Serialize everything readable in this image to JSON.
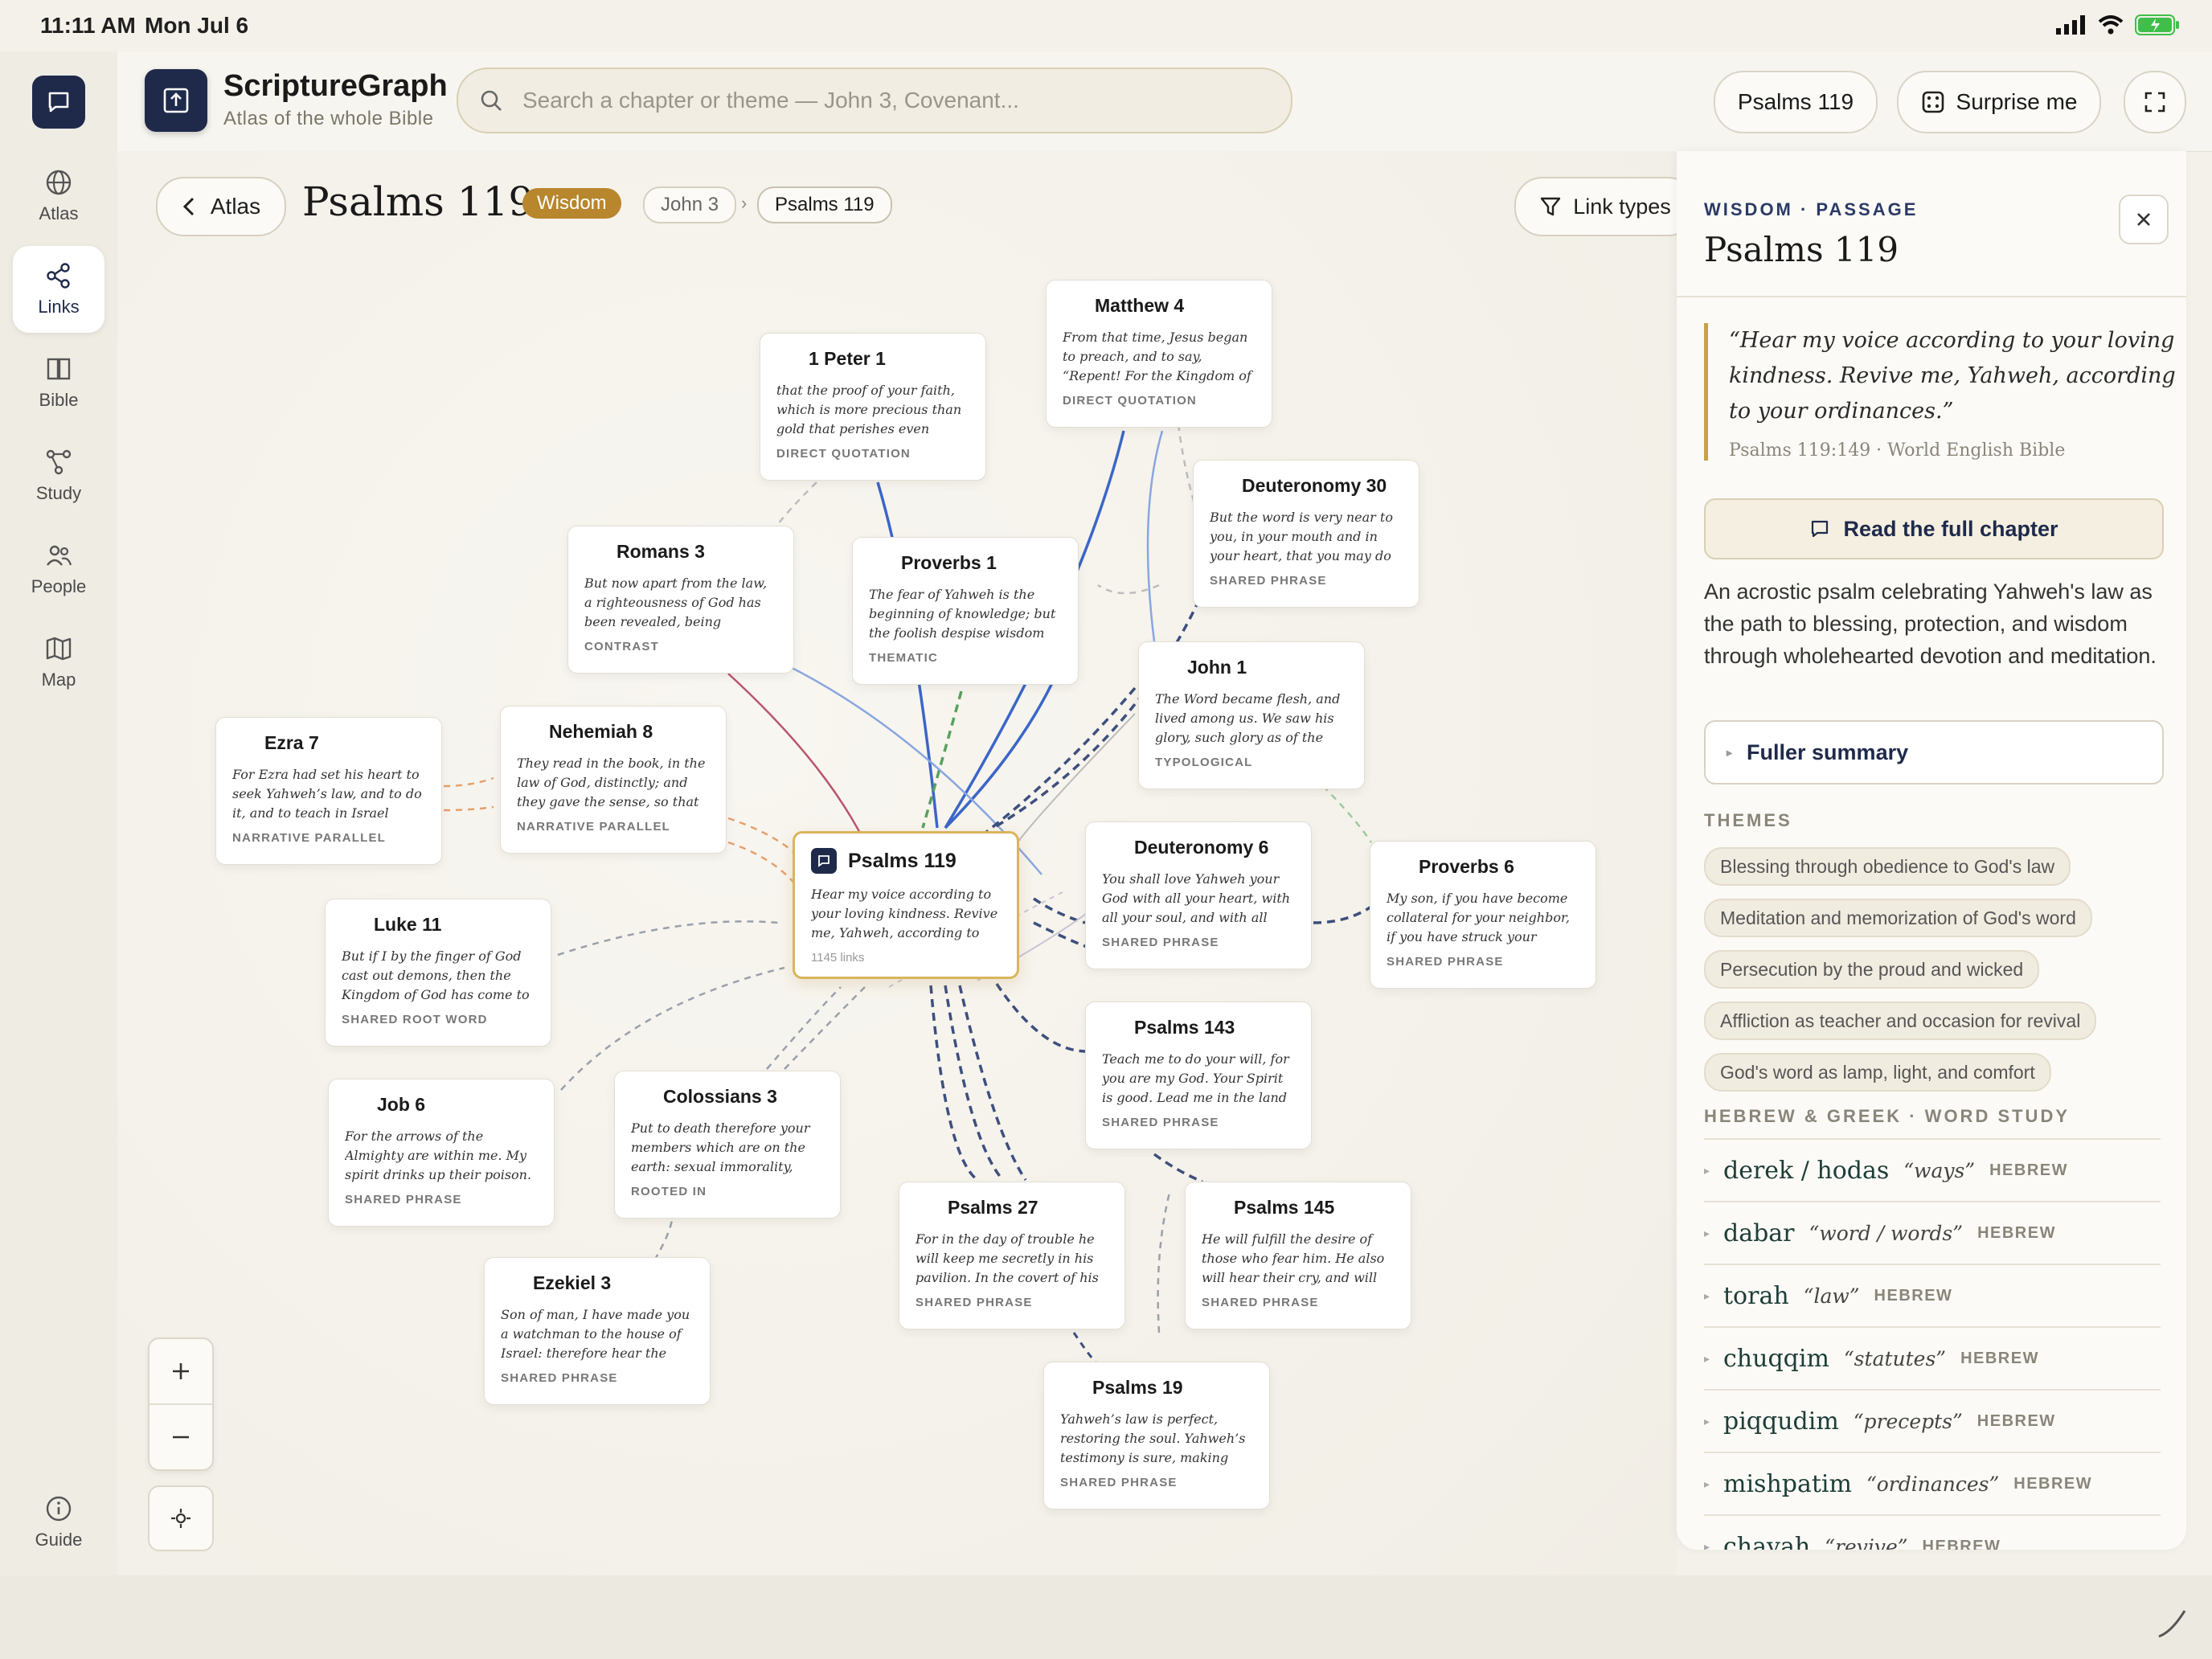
{
  "status": {
    "time": "11:11 AM",
    "date": "Mon Jul 6"
  },
  "rail": {
    "items": [
      {
        "label": "Atlas",
        "icon": "globe-icon"
      },
      {
        "label": "Links",
        "icon": "share-icon"
      },
      {
        "label": "Bible",
        "icon": "book-icon"
      },
      {
        "label": "Study",
        "icon": "graph-icon"
      },
      {
        "label": "People",
        "icon": "people-icon"
      },
      {
        "label": "Map",
        "icon": "map-icon"
      }
    ],
    "guide": "Guide"
  },
  "header": {
    "app_title": "ScriptureGraph",
    "app_subtitle": "Atlas of the whole Bible",
    "search_placeholder": "Search a chapter or theme — John 3, Covenant...",
    "current_chip": "Psalms 119",
    "surprise": "Surprise me"
  },
  "toolbar": {
    "back": "Atlas",
    "title": "Psalms 119",
    "category": "Wisdom",
    "crumbs": [
      "John 3",
      "Psalms 119"
    ],
    "link_types": "Link types"
  },
  "graph": {
    "center": {
      "title": "Psalms 119",
      "text": "Hear my voice according to your loving kindness. Revive me, Yahweh, according to your...",
      "links": "1145 links"
    },
    "nodes": [
      {
        "title": "Matthew 4",
        "text": "From that time, Jesus began to preach, and to say, “Repent! For the Kingdom of Heaven is at...",
        "label": "DIRECT QUOTATION"
      },
      {
        "title": "1 Peter 1",
        "text": "that the proof of your faith, which is more precious than gold that perishes even though it is tested ...",
        "label": "DIRECT QUOTATION"
      },
      {
        "title": "Deuteronomy 30",
        "text": "But the word is very near to you, in your mouth and in your heart, that you may do it.",
        "label": "SHARED PHRASE"
      },
      {
        "title": "Romans 3",
        "text": "But now apart from the law, a righteousness of God has been revealed, being testified by the la...",
        "label": "CONTRAST"
      },
      {
        "title": "Proverbs 1",
        "text": "The fear of Yahweh is the beginning of knowledge; but the foolish despise wisdom and instruction.",
        "label": "THEMATIC"
      },
      {
        "title": "John 1",
        "text": "The Word became flesh, and lived among us. We saw his glory, such glory as of the one and only Son ...",
        "label": "TYPOLOGICAL"
      },
      {
        "title": "Ezra 7",
        "text": "For Ezra had set his heart to seek Yahweh’s law, and to do it, and to teach in Israel statutes and...",
        "label": "NARRATIVE PARALLEL"
      },
      {
        "title": "Nehemiah 8",
        "text": "They read in the book, in the law of God, distinctly; and they gave the sense, so that they understood th...",
        "label": "NARRATIVE PARALLEL"
      },
      {
        "title": "Deuteronomy 6",
        "text": "You shall love Yahweh your God with all your heart, with all your soul, and with all your might.",
        "label": "SHARED PHRASE"
      },
      {
        "title": "Proverbs 6",
        "text": "My son, if you have become collateral for your neighbor, if you have struck your hands in pledge...",
        "label": "SHARED PHRASE"
      },
      {
        "title": "Luke 11",
        "text": "But if I by the finger of God cast out demons, then the Kingdom of God has come to you.",
        "label": "SHARED ROOT WORD"
      },
      {
        "title": "Psalms 143",
        "text": "Teach me to do your will, for you are my God. Your Spirit is good. Lead me in the land of uprightness.",
        "label": "SHARED PHRASE"
      },
      {
        "title": "Job 6",
        "text": "For the arrows of the Almighty are within me. My spirit drinks up their poison. The terrors of God s...",
        "label": "SHARED PHRASE"
      },
      {
        "title": "Colossians 3",
        "text": "Put to death therefore your members which are on the earth: sexual immorality, uncleanness,...",
        "label": "ROOTED IN"
      },
      {
        "title": "Psalms 27",
        "text": "For in the day of trouble he will keep me secretly in his pavilion. In the covert of his tabernacle he wi...",
        "label": "SHARED PHRASE"
      },
      {
        "title": "Psalms 145",
        "text": "He will fulfill the desire of those who fear him. He also will hear their cry, and will save them.",
        "label": "SHARED PHRASE"
      },
      {
        "title": "Ezekiel 3",
        "text": "Son of man, I have made you a watchman to the house of Israel: therefore hear the word from my...",
        "label": "SHARED PHRASE"
      },
      {
        "title": "Psalms 19",
        "text": "Yahweh’s law is perfect, restoring the soul. Yahweh’s testimony is sure, making wise the simple.",
        "label": "SHARED PHRASE"
      }
    ]
  },
  "panel": {
    "kicker": "WISDOM · PASSAGE",
    "title": "Psalms 119",
    "quote": "“Hear my voice according to your loving kindness. Revive me, Yahweh, according to your ordinances.”",
    "quote_ref": "Psalms 119:149 · World English Bible",
    "read_btn": "Read the full chapter",
    "summary": "An acrostic psalm celebrating Yahweh's law as the path to blessing, protection, and wisdom through wholehearted devotion and meditation.",
    "fuller": "Fuller summary",
    "themes_label": "THEMES",
    "themes": [
      "Blessing through obedience to God's law",
      "Meditation and memorization of God's word",
      "Persecution by the proud and wicked",
      "Affliction as teacher and occasion for revival",
      "God's word as lamp, light, and comfort"
    ],
    "words_label": "HEBREW & GREEK · WORD STUDY",
    "words": [
      {
        "word": "derek / hodas",
        "gloss": "“ways”",
        "lang": "HEBREW"
      },
      {
        "word": "dabar",
        "gloss": "“word / words”",
        "lang": "HEBREW"
      },
      {
        "word": "torah",
        "gloss": "“law”",
        "lang": "HEBREW"
      },
      {
        "word": "chuqqim",
        "gloss": "“statutes”",
        "lang": "HEBREW"
      },
      {
        "word": "piqqudim",
        "gloss": "“precepts”",
        "lang": "HEBREW"
      },
      {
        "word": "mishpatim",
        "gloss": "“ordinances”",
        "lang": "HEBREW"
      },
      {
        "word": "chayah",
        "gloss": "“revive”",
        "lang": "HEBREW"
      }
    ]
  },
  "colors": {
    "accent": "#1f2a4b",
    "gold": "#b8862d",
    "link_blue": "#3b66c8",
    "link_navy": "#3e4f7e",
    "link_green": "#4f9a58",
    "link_red": "#b8566a",
    "link_orange": "#e5a06a"
  }
}
